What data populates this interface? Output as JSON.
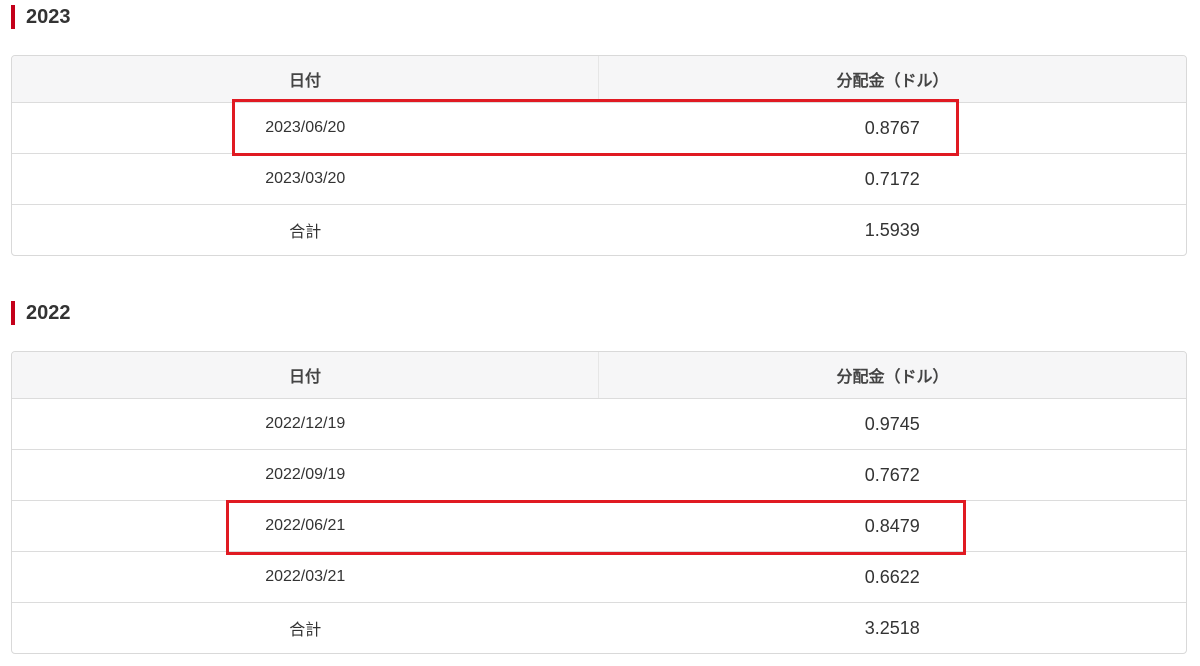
{
  "columns": {
    "date": "日付",
    "amount": "分配金（ドル）"
  },
  "sections": [
    {
      "year": "2023",
      "rows": [
        {
          "date": "2023/06/20",
          "amount": "0.8767"
        },
        {
          "date": "2023/03/20",
          "amount": "0.7172"
        },
        {
          "date": "合計",
          "amount": "1.5939"
        }
      ]
    },
    {
      "year": "2022",
      "rows": [
        {
          "date": "2022/12/19",
          "amount": "0.9745"
        },
        {
          "date": "2022/09/19",
          "amount": "0.7672"
        },
        {
          "date": "2022/06/21",
          "amount": "0.8479"
        },
        {
          "date": "2022/03/21",
          "amount": "0.6622"
        },
        {
          "date": "合計",
          "amount": "3.2518"
        }
      ]
    }
  ],
  "colors": {
    "accent_bar": "#c4001a",
    "highlight": "#e01a22",
    "header_bg": "#f6f6f7",
    "border": "#d9d9d9"
  }
}
